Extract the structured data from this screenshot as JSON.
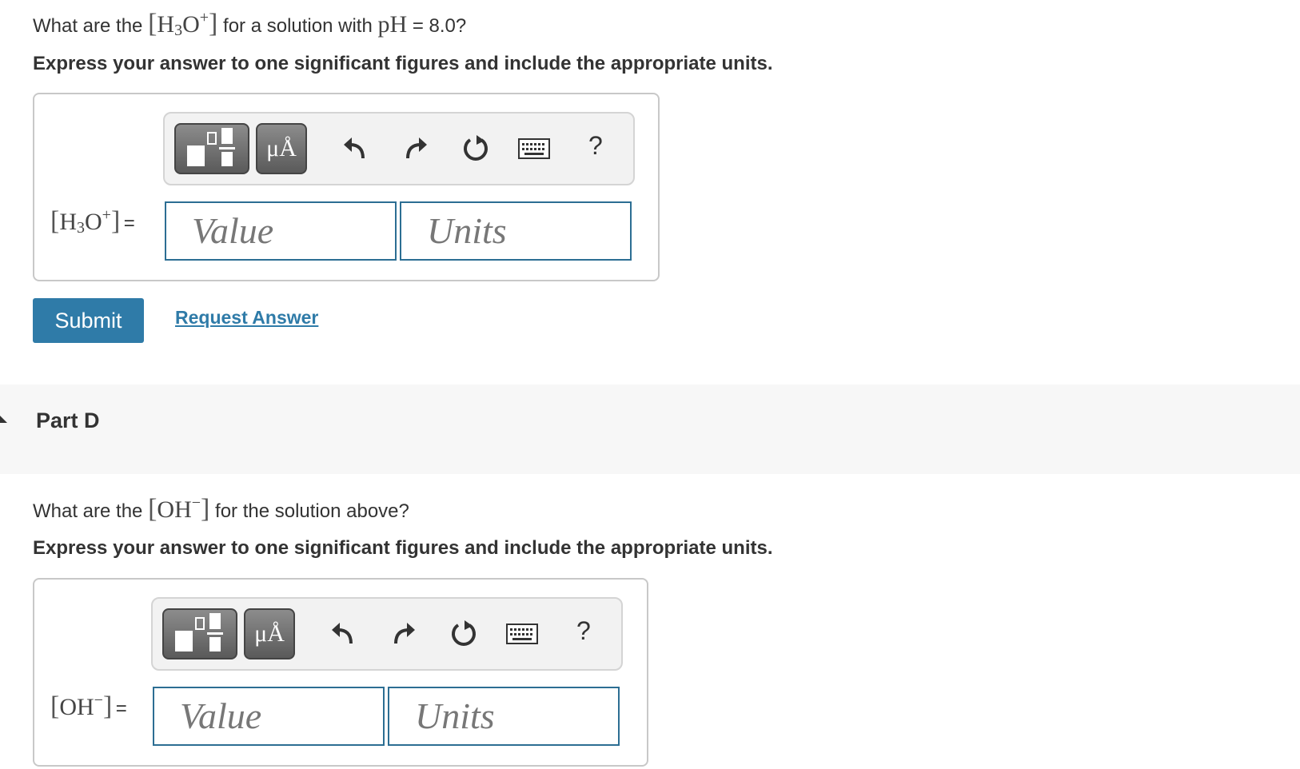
{
  "part_c": {
    "question_prefix": "What are the",
    "question_species_base": "H",
    "question_species_sub": "3",
    "question_species_o": "O",
    "question_species_sup": "+",
    "question_middle": "for a solution with",
    "question_ph_symbol": "pH",
    "question_suffix": "= 8.0?",
    "instruction": "Express your answer to one significant figures and include the appropriate units.",
    "toolbar": {
      "units_label": "μÅ",
      "help_label": "?"
    },
    "field_label_base": "H",
    "field_label_sub": "3",
    "field_label_o": "O",
    "field_label_sup": "+",
    "field_label_eq": "=",
    "value_placeholder": "Value",
    "units_placeholder": "Units"
  },
  "actions": {
    "submit_label": "Submit",
    "request_label": "Request Answer"
  },
  "part_d": {
    "title": "Part D",
    "question_prefix": "What are the",
    "question_species": "OH",
    "question_species_sup": "−",
    "question_suffix": "for the solution above?",
    "instruction": "Express your answer to one significant figures and include the appropriate units.",
    "toolbar": {
      "units_label": "μÅ",
      "help_label": "?"
    },
    "field_label": "OH",
    "field_label_sup": "−",
    "field_label_eq": "=",
    "value_placeholder": "Value",
    "units_placeholder": "Units"
  },
  "colors": {
    "accent": "#2f7ba8",
    "input_border": "#2c6e93",
    "band_bg": "#f7f7f7"
  },
  "icons": [
    "template-icon",
    "undo-icon",
    "redo-icon",
    "reset-icon",
    "keyboard-icon",
    "help-icon"
  ]
}
